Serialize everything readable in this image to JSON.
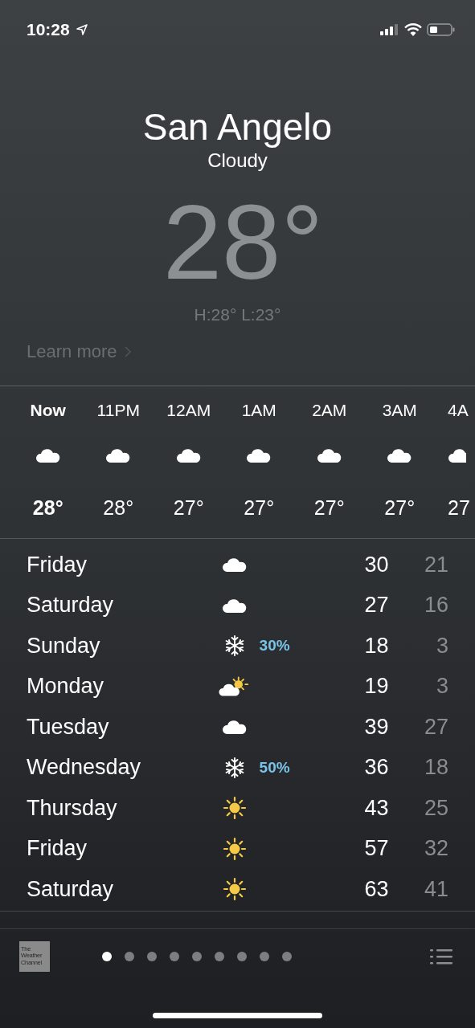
{
  "status_bar": {
    "time": "10:28"
  },
  "location": {
    "city": "San Angelo",
    "condition": "Cloudy",
    "temperature": "28°",
    "high_low": "H:28°  L:23°",
    "link": "Learn more"
  },
  "hourly": [
    {
      "time": "Now",
      "kind": "cloud",
      "temp": "28°",
      "current": true
    },
    {
      "time": "11PM",
      "kind": "cloud",
      "temp": "28°",
      "current": false
    },
    {
      "time": "12AM",
      "kind": "cloud",
      "temp": "27°",
      "current": false
    },
    {
      "time": "1AM",
      "kind": "cloud",
      "temp": "27°",
      "current": false
    },
    {
      "time": "2AM",
      "kind": "cloud",
      "temp": "27°",
      "current": false
    },
    {
      "time": "3AM",
      "kind": "cloud",
      "temp": "27°",
      "current": false
    },
    {
      "time": "4A",
      "kind": "cloud",
      "temp": "27",
      "current": false
    }
  ],
  "daily": [
    {
      "day": "Friday",
      "kind": "cloud",
      "high": "30",
      "low": "21"
    },
    {
      "day": "Saturday",
      "kind": "cloud",
      "high": "27",
      "low": "16"
    },
    {
      "day": "Sunday",
      "kind": "snow",
      "precip": "30%",
      "high": "18",
      "low": "3"
    },
    {
      "day": "Monday",
      "kind": "partly",
      "high": "19",
      "low": "3"
    },
    {
      "day": "Tuesday",
      "kind": "cloud",
      "high": "39",
      "low": "27"
    },
    {
      "day": "Wednesday",
      "kind": "snow",
      "precip": "50%",
      "high": "36",
      "low": "18"
    },
    {
      "day": "Thursday",
      "kind": "sun",
      "high": "43",
      "low": "25"
    },
    {
      "day": "Friday",
      "kind": "sun",
      "high": "57",
      "low": "32"
    },
    {
      "day": "Saturday",
      "kind": "sun",
      "high": "63",
      "low": "41"
    }
  ],
  "footer": {
    "logo": [
      "The",
      "Weather",
      "Channel"
    ],
    "pages": [
      {
        "selected": true
      },
      {
        "selected": false
      },
      {
        "selected": false
      },
      {
        "selected": false
      },
      {
        "selected": false
      },
      {
        "selected": false
      },
      {
        "selected": false
      },
      {
        "selected": false
      },
      {
        "selected": false
      }
    ]
  }
}
